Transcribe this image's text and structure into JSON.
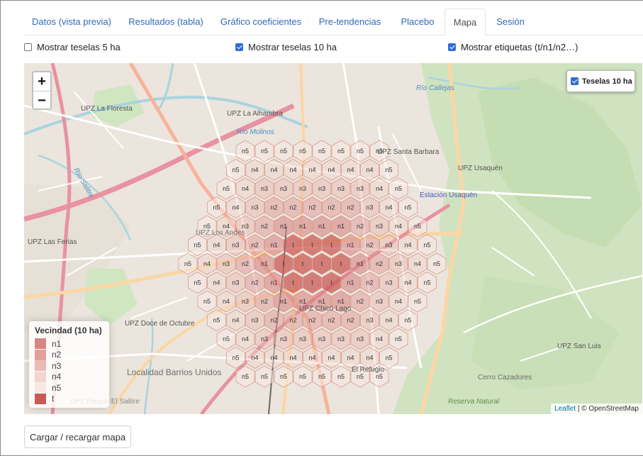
{
  "tabs": [
    {
      "label": "Datos (vista previa)",
      "active": false
    },
    {
      "label": "Resultados (tabla)",
      "active": false
    },
    {
      "label": "Gráfico coeficientes",
      "active": false
    },
    {
      "label": "Pre-tendencias",
      "active": false
    },
    {
      "label": "Placebo",
      "active": false
    },
    {
      "label": "Mapa",
      "active": true
    },
    {
      "label": "Sesión",
      "active": false
    }
  ],
  "options": {
    "teselas5": {
      "label": "Mostrar teselas 5 ha",
      "checked": false
    },
    "teselas10": {
      "label": "Mostrar teselas 10 ha",
      "checked": true
    },
    "etiquetas": {
      "label": "Mostrar etiquetas (t/n1/n2…)",
      "checked": true
    }
  },
  "map": {
    "zoom_in": "+",
    "zoom_out": "−",
    "layer_control": {
      "label": "Teselas 10 ha",
      "checked": true
    },
    "legend": {
      "title": "Vecindad (10 ha)",
      "items": [
        {
          "label": "n1",
          "color": "#d98585"
        },
        {
          "label": "n2",
          "color": "#e2a09c"
        },
        {
          "label": "n3",
          "color": "#ebbcb4"
        },
        {
          "label": "n4",
          "color": "#f2d6cc"
        },
        {
          "label": "n5",
          "color": "#f7e9e1"
        },
        {
          "label": "t",
          "color": "#cb5a55"
        }
      ]
    },
    "place_labels": [
      "UPZ La Floresta",
      "UPZ La Alhambra",
      "UPZ Santa Barbara",
      "UPZ Usaquén",
      "Estación Usaquén",
      "UPZ Los Andes",
      "UPZ Las Ferias",
      "UPZ Doce de Octubre",
      "Localidad Barrios Unidos",
      "UPZ Chicó Lago",
      "El Refugio",
      "UPZ San Luis",
      "Cerro Cazadores",
      "Reserva Natural",
      "Río Salitre",
      "Río Molinos",
      "Río Callejas",
      "UPZ Parque El Salitre"
    ],
    "attribution": {
      "leaflet": "Leaflet",
      "osm": "© OpenStreetMap"
    }
  },
  "actions": {
    "load_map": "Cargar / recargar mapa"
  }
}
